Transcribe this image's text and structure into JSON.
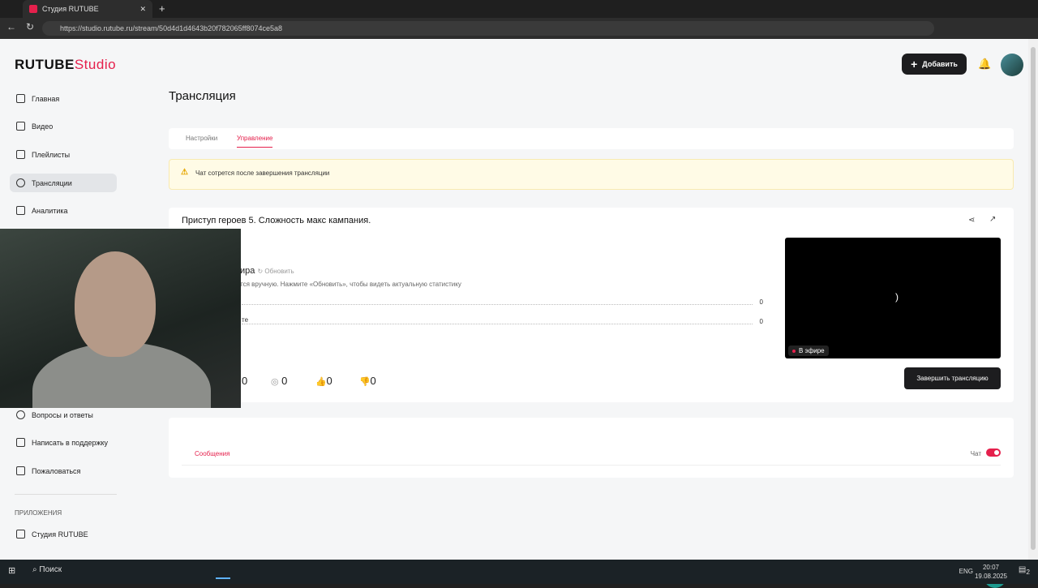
{
  "browser": {
    "tab_title": "Студия RUTUBE",
    "url": "https://studio.rutube.ru/stream/50d4d1d4643b20f782065ff8074ce5a8"
  },
  "logo": {
    "main": "RUTUBE",
    "accent": "Studio"
  },
  "header": {
    "add_label": "Добавить"
  },
  "sidebar": {
    "items": [
      {
        "label": "Главная"
      },
      {
        "label": "Видео"
      },
      {
        "label": "Плейлисты"
      },
      {
        "label": "Трансляции"
      },
      {
        "label": "Аналитика"
      },
      {
        "label": "Вопросы и ответы"
      },
      {
        "label": "Написать в поддержку"
      },
      {
        "label": "Пожаловаться"
      }
    ],
    "apps_heading": "ПРИЛОЖЕНИЯ",
    "apps": [
      {
        "label": "Студия RUTUBE"
      }
    ]
  },
  "page": {
    "title": "Трансляция",
    "tabs": [
      {
        "label": "Настройки"
      },
      {
        "label": "Управление"
      }
    ],
    "warning": "Чат сотрется после завершения трансляции"
  },
  "stream": {
    "title": "Приступ героев 5. Сложность макс кампания.",
    "stats_heading": "ира",
    "refresh": "Обновить",
    "stats_note": "тся вручную. Нажмите «Обновить», чтобы видеть актуальную статистику",
    "rows": [
      {
        "label": "",
        "value": "0"
      },
      {
        "label": "те",
        "value": "0"
      }
    ],
    "counters": {
      "views": "0",
      "viewers": "0",
      "likes": "0",
      "dislikes": "0"
    },
    "live_label": "В эфире",
    "end_button": "Завершить трансляцию"
  },
  "chat": {
    "tab": "Сообщения",
    "toggle_label": "Чат",
    "enabled": true
  },
  "taskbar": {
    "search": "Поиск",
    "lang": "ENG",
    "time": "20:07",
    "date": "19.08.2025",
    "notifications": "2"
  },
  "colors": {
    "accent": "#e5204c"
  }
}
